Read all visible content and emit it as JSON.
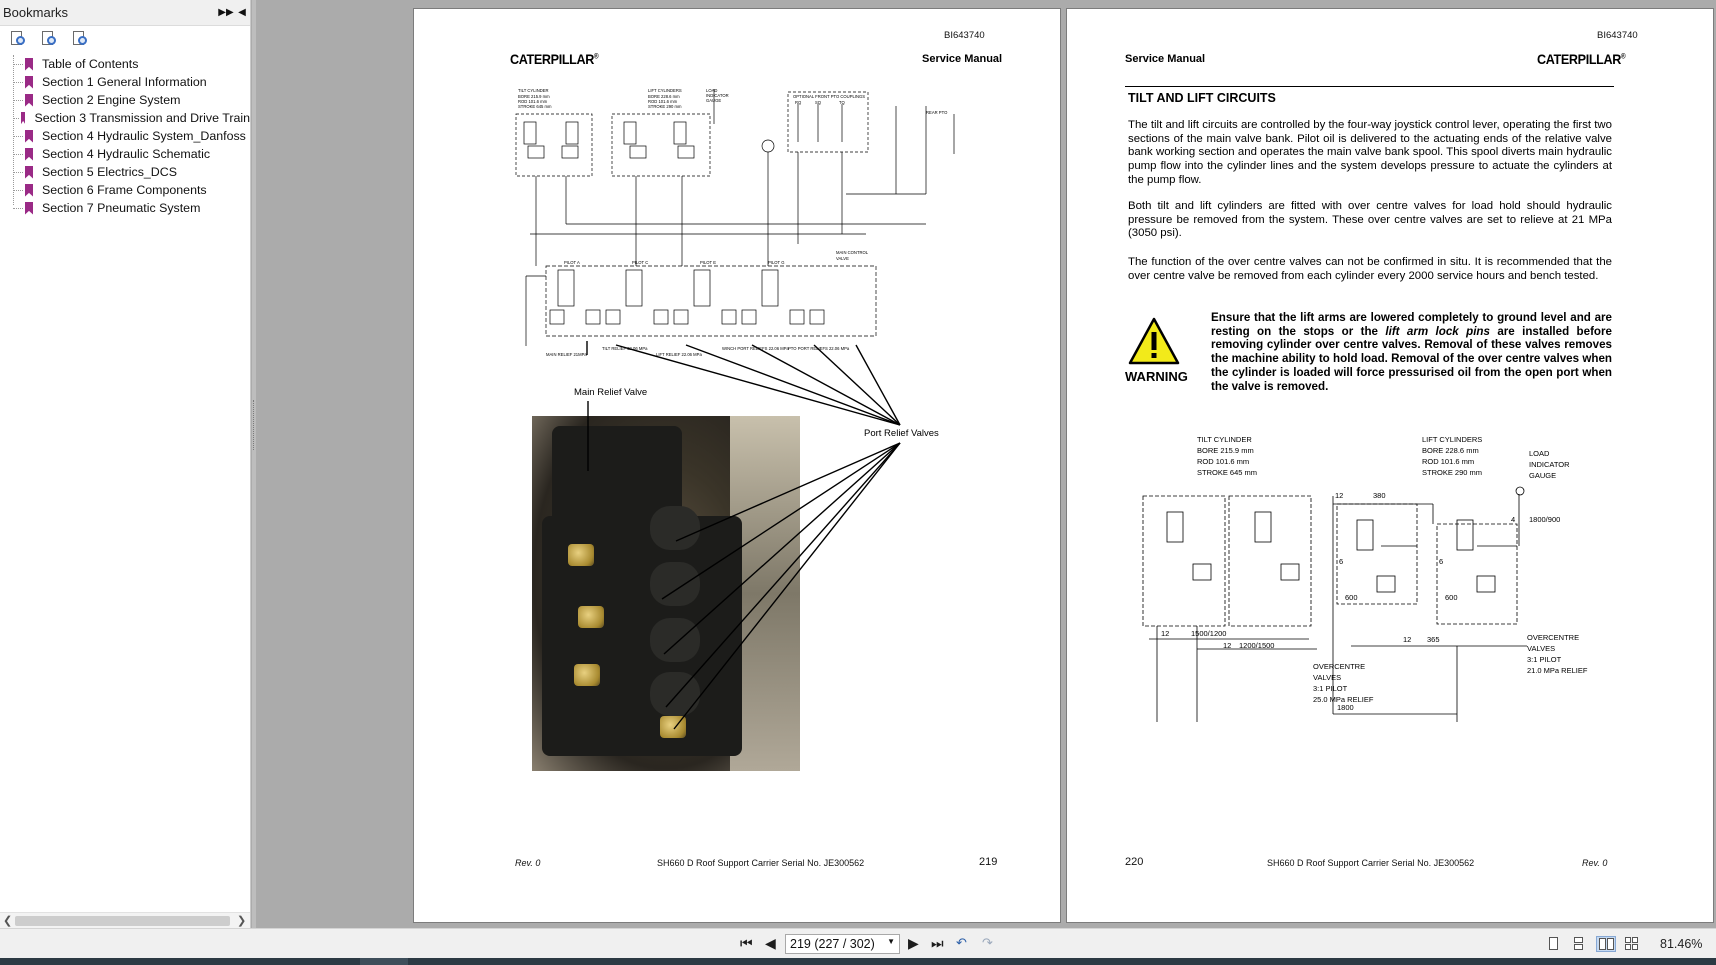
{
  "sidebar": {
    "title": "Bookmarks",
    "items": [
      {
        "label": "Table of Contents"
      },
      {
        "label": "Section 1 General Information"
      },
      {
        "label": "Section 2 Engine System"
      },
      {
        "label": "Section 3 Transmission and Drive Train"
      },
      {
        "label": "Section 4 Hydraulic System_Danfoss"
      },
      {
        "label": "Section 4 Hydraulic Schematic"
      },
      {
        "label": "Section 5 Electrics_DCS"
      },
      {
        "label": "Section 6 Frame Components"
      },
      {
        "label": "Section 7 Pneumatic System"
      }
    ]
  },
  "left_page": {
    "doc_id": "BI643740",
    "brand": "CATERPILLAR",
    "header": "Service Manual",
    "label_main_relief": "Main Relief Valve",
    "label_port_relief": "Port Relief Valves",
    "footer_rev": "Rev. 0",
    "footer_center": "SH660 D Roof Support Carrier Serial No. JE300562",
    "page_number": "219",
    "schematic": {
      "tilt_cyl": [
        "TILT CYLINDER",
        "BORE 215.9 mm",
        "ROD 101.6 mm",
        "STROKE 645 mm"
      ],
      "lift_cyl": [
        "LIFT CYLINDERS",
        "BORE 228.6 mm",
        "ROD 101.6 mm",
        "STROKE 290 mm"
      ],
      "load_gauge": [
        "LOAD",
        "INDICATOR",
        "GAUGE"
      ],
      "optional_pto": "OPTIONAL FRONT PTO COUPLINGS",
      "rear_pto": "REAR PTO",
      "ports": [
        "RQ",
        "SQ",
        "TQ"
      ],
      "pilots": [
        "PILOT A",
        "PILOT C",
        "PILOT E",
        "PILOT G"
      ],
      "main_control": [
        "MAIN CONTROL",
        "VALVE"
      ],
      "bottom_labels": [
        "MAIN RELIEF 21MPa",
        "TILT RELIEF 22.06 MPa",
        "LIFT RELIEF 22.06 MPa",
        "WINCH PORT RELIEFS 22.06 MPa",
        "PTO PORT RELIEFS 22.06 MPa"
      ]
    }
  },
  "right_page": {
    "doc_id": "BI643740",
    "brand": "CATERPILLAR",
    "header": "Service Manual",
    "title": "TILT AND LIFT CIRCUITS",
    "para1": "The tilt and lift circuits are controlled by the four-way joystick control lever, operating the first two sections of the main valve bank. Pilot oil is delivered to the actuating ends of the relative valve bank working section and operates the main valve bank spool. This spool diverts main hydraulic pump flow into the cylinder lines and the system develops pressure to actuate the cylinders at the pump flow.",
    "para2": "Both tilt and lift cylinders are fitted with over centre valves for load hold should hydraulic pressure be removed from the system. These over centre valves are set to relieve at 21 MPa (3050 psi).",
    "para3": "The function of the over centre valves can not be confirmed in situ. It is recommended that the over centre valve be removed from each cylinder every 2000 service hours and bench tested.",
    "warning_label": "WARNING",
    "warning_a": "Ensure that the lift arms are lowered completely to ground level and are resting on the stops or the ",
    "warning_em": "lift arm lock pins",
    "warning_b": " are installed before removing cylinder over centre valves. Removal of these valves removes the machine ability to hold load. Removal of the over centre valves when the cylinder is loaded will force pressurised oil from the open port when the valve is removed.",
    "schematic": {
      "tilt_cyl": [
        "TILT CYLINDER",
        "BORE 215.9 mm",
        "ROD 101.6 mm",
        "STROKE 645 mm"
      ],
      "lift_cyl": [
        "LIFT CYLINDERS",
        "BORE 228.6 mm",
        "ROD 101.6 mm",
        "STROKE 290 mm"
      ],
      "load_gauge": [
        "LOAD",
        "INDICATOR",
        "GAUGE"
      ],
      "gauge_val": "1800/900",
      "oc_left": [
        "OVERCENTRE",
        "VALVES",
        "3:1 PILOT",
        "25.0 MPa RELIEF"
      ],
      "oc_right": [
        "OVERCENTRE",
        "VALVES",
        "3:1 PILOT",
        "21.0 MPa RELIEF"
      ],
      "nums": [
        "12",
        "380",
        "6",
        "6",
        "600",
        "600",
        "12",
        "1500/1200",
        "12",
        "1200/1500",
        "12",
        "365",
        "1800",
        "4"
      ]
    },
    "footer_rev": "Rev. 0",
    "footer_center": "SH660 D Roof Support Carrier Serial No. JE300562",
    "page_number": "220"
  },
  "toolbar": {
    "page_field": "219 (227 / 302)",
    "zoom": "81.46%"
  }
}
